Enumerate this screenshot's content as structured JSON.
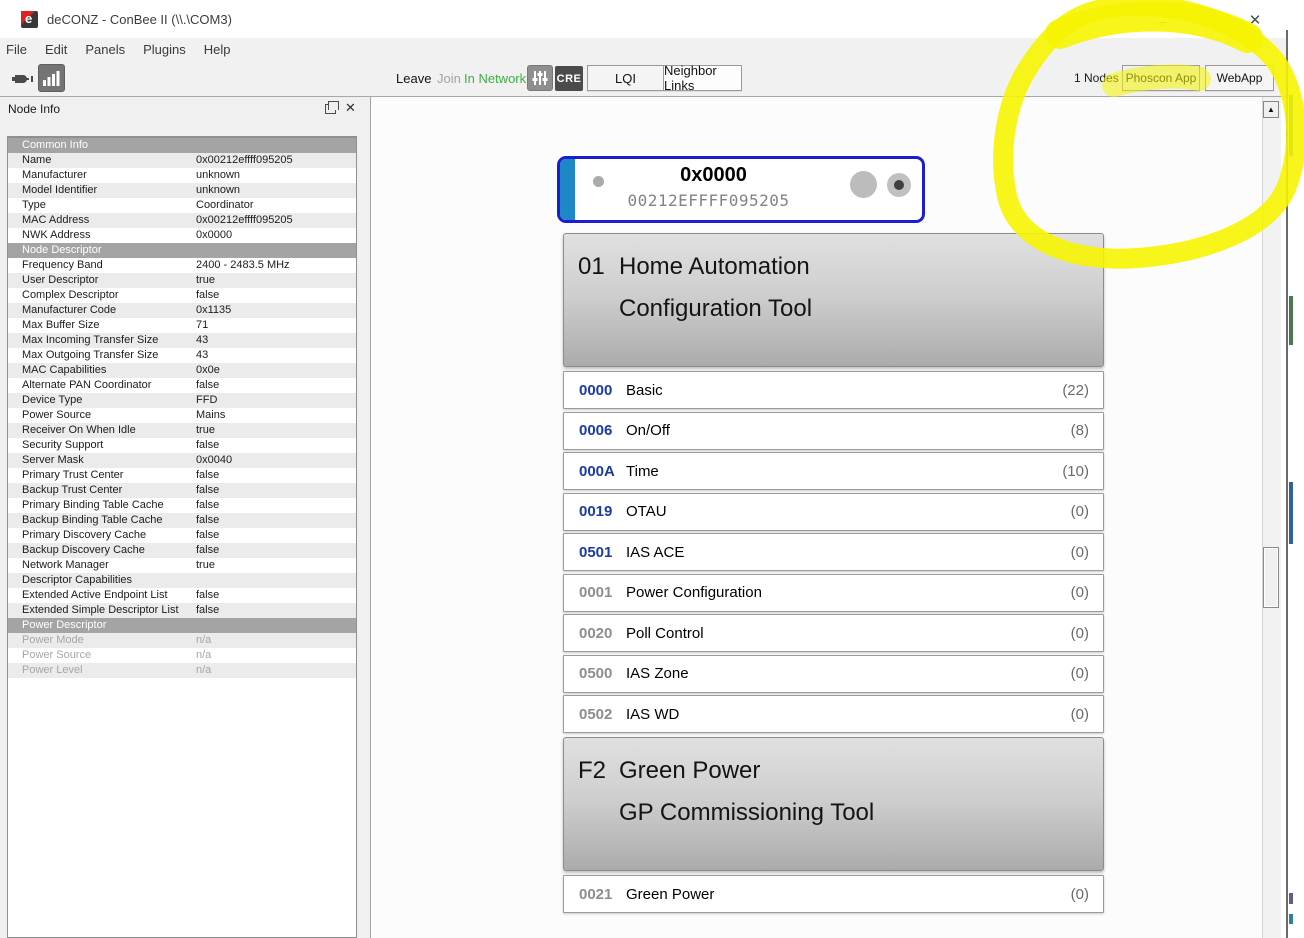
{
  "window": {
    "title": "deCONZ - ConBee II (\\\\.\\COM3)",
    "controls": {
      "minimize": "–",
      "maximize": "",
      "close": "✕"
    }
  },
  "menu": {
    "items": [
      "File",
      "Edit",
      "Panels",
      "Plugins",
      "Help"
    ]
  },
  "toolbar": {
    "leave": "Leave",
    "join": "Join",
    "network_status": "In Network",
    "network_status_color": "#3cb043",
    "cre": "CRE",
    "lqi": "LQI",
    "neighbor_links": "Neighbor Links",
    "nodes_count": "1 Nodes",
    "phoscon": "Phoscon App",
    "webapp": "WebApp"
  },
  "icons": {
    "app": "deconz-logo",
    "plug": "serial-port-icon",
    "signal": "signal-bars-icon",
    "sliders": "filter-sliders-icon",
    "panel_float": "float-panel-icon",
    "panel_close": "close-icon",
    "scroll_up": "▲"
  },
  "node_info": {
    "title": "Node Info",
    "rows": [
      {
        "header": "Common Info"
      },
      {
        "label": "Name",
        "value": "0x00212effff095205"
      },
      {
        "label": "Manufacturer",
        "value": "unknown"
      },
      {
        "label": "Model Identifier",
        "value": "unknown"
      },
      {
        "label": "Type",
        "value": "Coordinator"
      },
      {
        "label": "MAC Address",
        "value": "0x00212effff095205"
      },
      {
        "label": "NWK Address",
        "value": "0x0000"
      },
      {
        "header": "Node Descriptor"
      },
      {
        "label": "Frequency Band",
        "value": "2400 - 2483.5 MHz"
      },
      {
        "label": "User Descriptor",
        "value": "true"
      },
      {
        "label": "Complex Descriptor",
        "value": "false"
      },
      {
        "label": "Manufacturer Code",
        "value": "0x1135"
      },
      {
        "label": "Max Buffer Size",
        "value": "71"
      },
      {
        "label": "Max Incoming Transfer Size",
        "value": "43"
      },
      {
        "label": "Max Outgoing Transfer Size",
        "value": "43"
      },
      {
        "label": "MAC Capabilities",
        "value": "0x0e"
      },
      {
        "label": "Alternate PAN Coordinator",
        "value": "false"
      },
      {
        "label": "Device Type",
        "value": "FFD"
      },
      {
        "label": "Power Source",
        "value": "Mains"
      },
      {
        "label": "Receiver On When Idle",
        "value": "true"
      },
      {
        "label": "Security Support",
        "value": "false"
      },
      {
        "label": "Server Mask",
        "value": "0x0040"
      },
      {
        "label": "Primary Trust Center",
        "value": "false"
      },
      {
        "label": "Backup Trust Center",
        "value": "false"
      },
      {
        "label": "Primary Binding Table Cache",
        "value": "false"
      },
      {
        "label": "Backup Binding Table Cache",
        "value": "false"
      },
      {
        "label": "Primary Discovery Cache",
        "value": "false"
      },
      {
        "label": "Backup Discovery Cache",
        "value": "false"
      },
      {
        "label": "Network Manager",
        "value": "true"
      },
      {
        "label": "Descriptor Capabilities",
        "value": ""
      },
      {
        "label": "Extended Active Endpoint List",
        "value": "false"
      },
      {
        "label": "Extended Simple Descriptor List",
        "value": "false"
      },
      {
        "header": "Power Descriptor"
      },
      {
        "label": "Power Mode",
        "value": "n/a"
      },
      {
        "label": "Power Source",
        "value": "n/a"
      },
      {
        "label": "Power Level",
        "value": "n/a"
      }
    ]
  },
  "canvas": {
    "node": {
      "nwk": "0x0000",
      "mac": "00212EFFFF095205"
    },
    "endpoints": [
      {
        "id": "01",
        "profile": "Home Automation",
        "device": "Configuration Tool",
        "clusters": [
          {
            "id": "0000",
            "name": "Basic",
            "count": "(22)",
            "in": true
          },
          {
            "id": "0006",
            "name": "On/Off",
            "count": "(8)",
            "in": true
          },
          {
            "id": "000A",
            "name": "Time",
            "count": "(10)",
            "in": true
          },
          {
            "id": "0019",
            "name": "OTAU",
            "count": "(0)",
            "in": true
          },
          {
            "id": "0501",
            "name": "IAS ACE",
            "count": "(0)",
            "in": true
          },
          {
            "id": "0001",
            "name": "Power Configuration",
            "count": "(0)",
            "in": false
          },
          {
            "id": "0020",
            "name": "Poll Control",
            "count": "(0)",
            "in": false
          },
          {
            "id": "0500",
            "name": "IAS Zone",
            "count": "(0)",
            "in": false
          },
          {
            "id": "0502",
            "name": "IAS WD",
            "count": "(0)",
            "in": false
          }
        ]
      },
      {
        "id": "F2",
        "profile": "Green Power",
        "device": "GP Commissioning Tool",
        "clusters": [
          {
            "id": "0021",
            "name": "Green Power",
            "count": "(0)",
            "in": false
          }
        ]
      }
    ]
  },
  "colors": {
    "marker_yellow": "#f6f400",
    "cluster_in_id": "#1b3aa5",
    "cluster_out_id": "#8d8d8d",
    "node_border_blue": "#1d1dcf",
    "node_strip_blue": "#1e87c8"
  }
}
